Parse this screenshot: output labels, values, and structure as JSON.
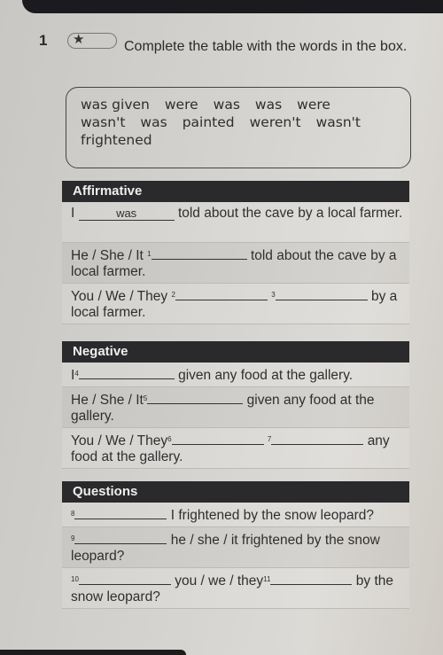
{
  "exercise": {
    "number": "1",
    "difficulty_icon": "star-icon",
    "difficulty_symbol": "★",
    "instruction": "Complete the table with the words in the box."
  },
  "word_box": {
    "words": [
      "was given",
      "were",
      "was",
      "was",
      "were",
      "wasn't",
      "was",
      "painted",
      "weren't",
      "wasn't",
      "frightened"
    ]
  },
  "sections": {
    "affirmative": {
      "title": "Affirmative",
      "rows": [
        {
          "pre": "I",
          "blank_num": "",
          "answer": "was",
          "post": "told about the cave by a local farmer."
        },
        {
          "pre": "He / She / It",
          "blank_num": "1",
          "answer": "",
          "post": "told about the cave by a local farmer."
        },
        {
          "pre": "You / We / They",
          "blank_num": "2",
          "answer": "",
          "mid_num": "3",
          "post": "by a local farmer."
        }
      ]
    },
    "negative": {
      "title": "Negative",
      "rows": [
        {
          "pre": "I",
          "blank_num": "4",
          "post": "given any food at the gallery."
        },
        {
          "pre": "He / She / It",
          "blank_num": "5",
          "post": "given any food at the gallery."
        },
        {
          "pre": "You / We / They",
          "blank_num": "6",
          "mid_num": "7",
          "post": "any food at the gallery."
        }
      ]
    },
    "questions": {
      "title": "Questions",
      "rows": [
        {
          "blank_num": "8",
          "post": "I frightened by the snow leopard?"
        },
        {
          "blank_num": "9",
          "post": "he / she / it frightened by the snow leopard?"
        },
        {
          "blank_num": "10",
          "mid_text": "you / we / they",
          "mid_num": "11",
          "post": "by the snow leopard?"
        }
      ]
    }
  }
}
